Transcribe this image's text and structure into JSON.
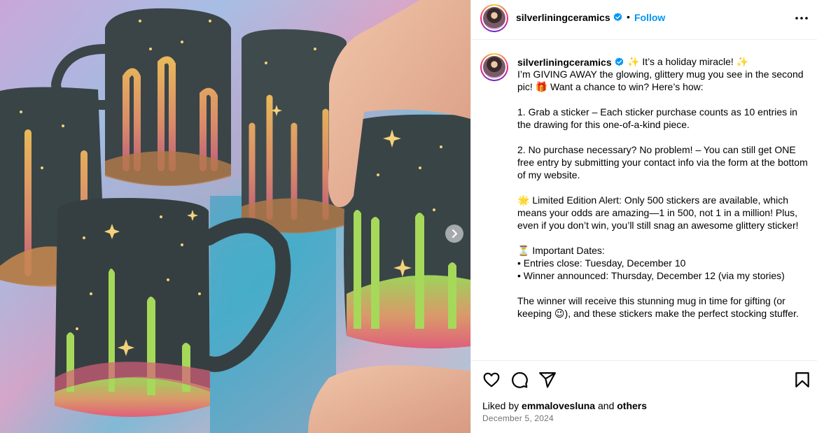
{
  "post": {
    "username": "silverliningceramics",
    "follow_label": "Follow",
    "separator": "•",
    "caption": "✨ It’s a holiday miracle! ✨\nI’m GIVING AWAY the glowing, glittery mug you see in the second pic! 🎁 Want a chance to win? Here’s how:\n\n1. Grab a sticker – Each sticker purchase counts as 10 entries in the drawing for this one-of-a-kind piece.\n\n2. No purchase necessary? No problem! – You can still get ONE free entry by submitting your contact info via the form at the bottom of my website.\n\n🌟 Limited Edition Alert: Only 500 stickers are available, which means your odds are amazing—1 in 500, not 1 in a million! Plus, even if you don’t win, you’ll still snag an awesome glittery sticker!\n\n⏳ Important Dates:\n• Entries close: Tuesday, December 10\n• Winner announced: Thursday, December 12 (via my stories)\n\nThe winner will receive this stunning mug in time for gifting (or keeping 😉), and these stickers make the perfect stocking stuffer.",
    "liked_by_prefix": "Liked by",
    "liked_by_user": "emmalovesluna",
    "liked_by_and": "and",
    "liked_by_others": "others",
    "date": "December 5, 2024"
  },
  "icons": {
    "verified": "verified-badge-icon",
    "more": "more-options-icon",
    "like": "heart-icon",
    "comment": "comment-icon",
    "share": "share-icon",
    "save": "bookmark-icon",
    "next": "chevron-right-icon"
  },
  "colors": {
    "accent": "#0095f6",
    "muted": "#737373",
    "divider": "#efefef"
  }
}
